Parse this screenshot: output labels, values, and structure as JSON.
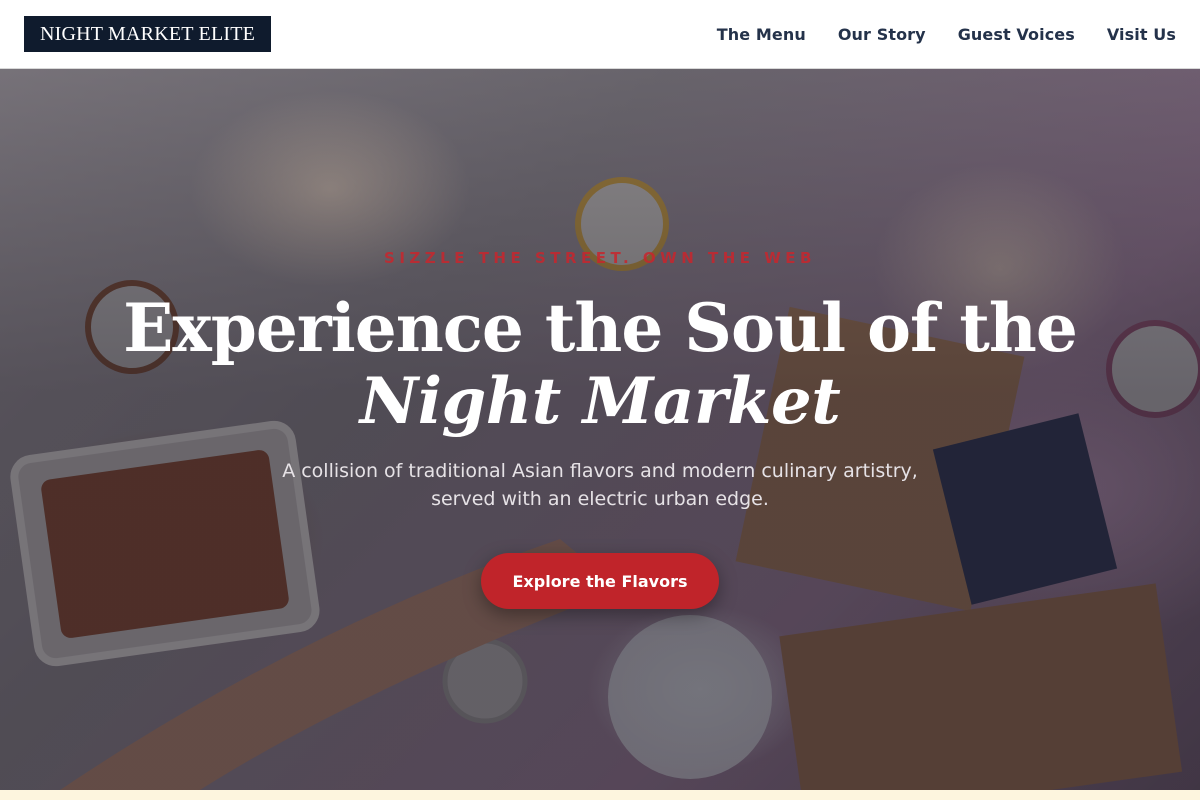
{
  "header": {
    "logo": "NIGHT MARKET ELITE",
    "nav": [
      "The Menu",
      "Our Story",
      "Guest Voices",
      "Visit Us"
    ]
  },
  "hero": {
    "tagline": "SIZZLE THE STREET. OWN THE WEB",
    "headline_line1": "Experience the Soul of the",
    "headline_line2": "Night Market",
    "subtitle": "A collision of traditional Asian flavors and modern culinary artistry, served with an electric urban edge.",
    "cta_label": "Explore the Flavors",
    "photo": "street-food-table-photo"
  },
  "colors": {
    "logo_bg": "#0f1b2d",
    "nav_text": "#24324a",
    "accent_red": "#c0242a",
    "headline_white": "#ffffff",
    "page_bg": "#fdf6e3"
  }
}
